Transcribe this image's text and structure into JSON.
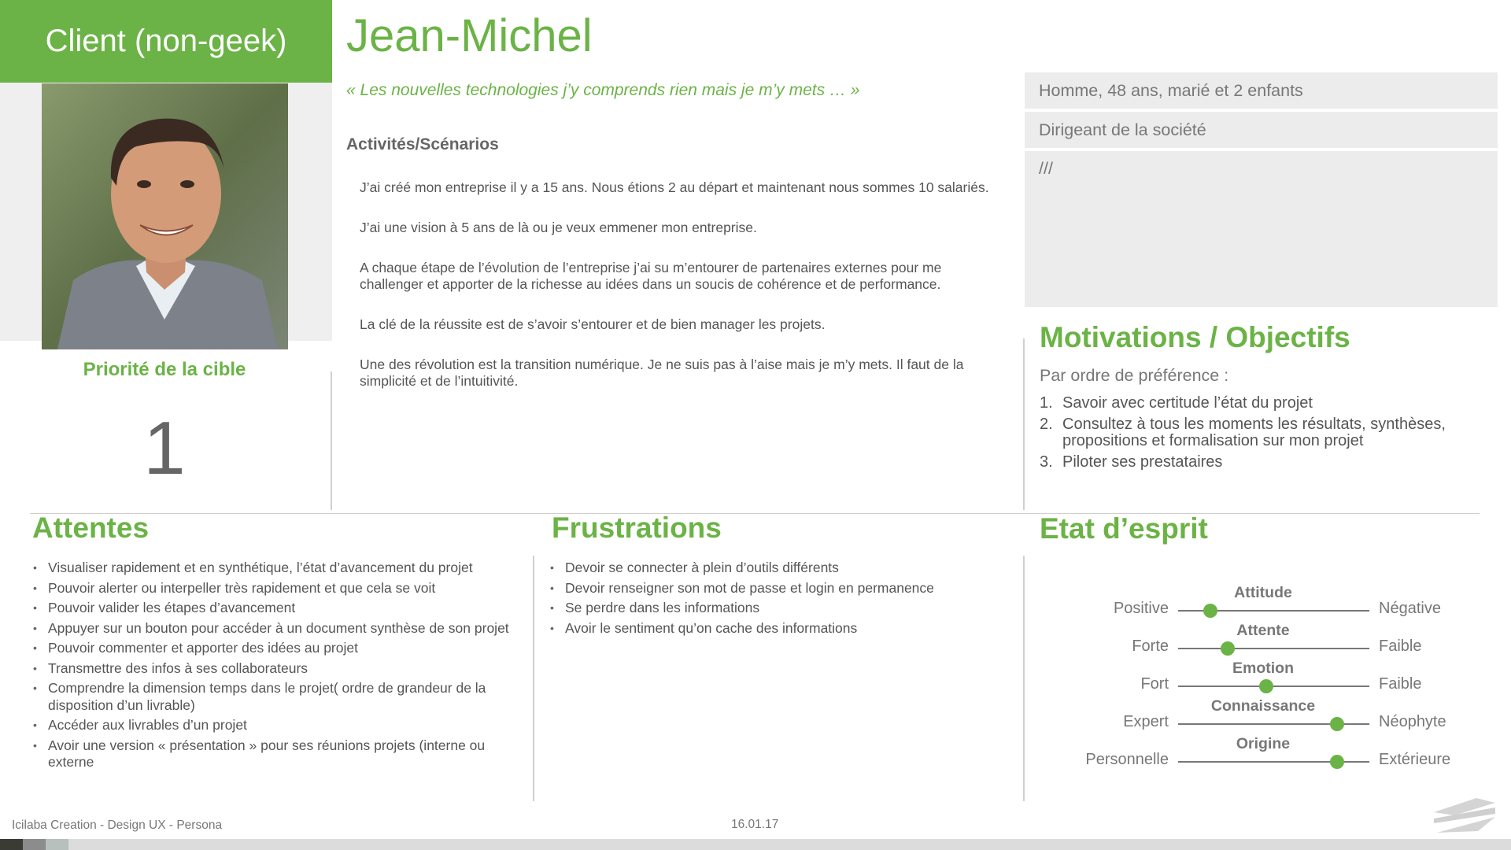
{
  "header": {
    "badge": "Client (non-geek)",
    "name": "Jean-Michel",
    "quote": "« Les nouvelles technologies j’y comprends rien mais je m’y mets … »"
  },
  "priority": {
    "label": "Priorité de la cible",
    "value": "1"
  },
  "activities": {
    "title": "Activités/Scénarios",
    "items": [
      "J’ai créé mon entreprise il y a 15 ans. Nous étions 2 au départ et maintenant nous sommes 10 salariés.",
      "J’ai une vision  à 5 ans de là ou je veux emmener mon entreprise.",
      "A chaque étape de l’évolution de l’entreprise j’ai su  m’entourer de partenaires externes pour me challenger et apporter de la richesse au idées dans un soucis de cohérence et de performance.",
      "La clé de la réussite est de s’avoir s’entourer et de bien manager les projets.",
      "Une des révolution est la transition numérique. Je ne suis pas à l’aise mais je m’y mets. Il faut de la simplicité et de l’intuitivité."
    ]
  },
  "info": {
    "line1": "Homme, 48 ans, marié et 2 enfants",
    "line2": "Dirigeant de la société",
    "line3": "///"
  },
  "motivations": {
    "title": "Motivations / Objectifs",
    "subtitle": "Par ordre de préférence :",
    "items": [
      {
        "num": "1.",
        "text": "Savoir avec certitude l’état du projet"
      },
      {
        "num": "2.",
        "text": "Consultez à tous les moments les résultats, synthèses, propositions et formalisation sur mon projet"
      },
      {
        "num": "3.",
        "text": "Piloter ses prestataires"
      }
    ]
  },
  "attentes": {
    "title": "Attentes",
    "items": [
      "Visualiser rapidement et en synthétique, l’état d’avancement du projet",
      "Pouvoir alerter ou interpeller très rapidement et que cela se voit",
      "Pouvoir valider les étapes d’avancement",
      "Appuyer sur un bouton pour accéder à un document synthèse de son projet",
      "Pouvoir commenter et apporter des idées au projet",
      "Transmettre des infos à ses collaborateurs",
      "Comprendre la dimension temps dans le projet( ordre de grandeur de la disposition d’un livrable)",
      "Accéder aux livrables d’un projet",
      "Avoir une version « présentation » pour ses réunions projets (interne ou externe"
    ]
  },
  "frustrations": {
    "title": "Frustrations",
    "items": [
      "Devoir se connecter à plein d’outils différents",
      "Devoir renseigner son mot de passe et login en permanence",
      "Se perdre dans les informations",
      "Avoir le sentiment qu’on cache des informations"
    ]
  },
  "etat": {
    "title": "Etat d’esprit",
    "sliders": [
      {
        "name": "Attitude",
        "left": "Positive",
        "right": "Négative",
        "level": 0.17
      },
      {
        "name": "Attente",
        "left": "Forte",
        "right": "Faible",
        "level": 0.26
      },
      {
        "name": "Emotion",
        "left": "Fort",
        "right": "Faible",
        "level": 0.46
      },
      {
        "name": "Connaissance",
        "left": "Expert",
        "right": "Néophyte",
        "level": 0.83
      },
      {
        "name": "Origine",
        "left": "Personnelle",
        "right": "Extérieure",
        "level": 0.83
      }
    ]
  },
  "footer": {
    "left": "Icilaba Creation - Design UX - Persona",
    "date": "16.01.17"
  },
  "colors": {
    "accent": "#6bb346",
    "text": "#555555",
    "panel": "#ececec"
  }
}
